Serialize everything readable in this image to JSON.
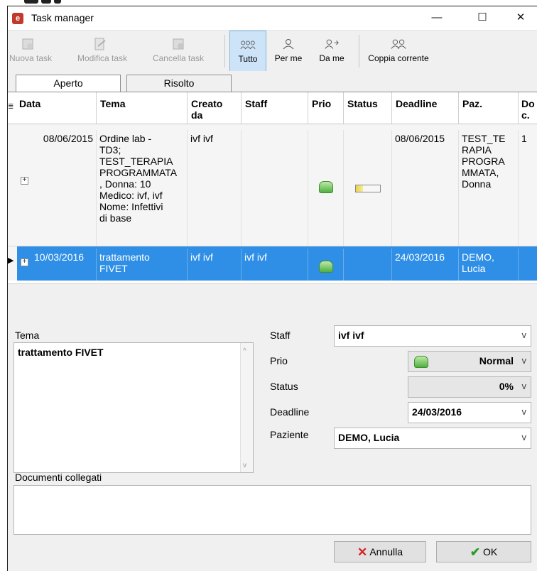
{
  "window": {
    "title": "Task manager",
    "minimize": "—",
    "maximize": "☐",
    "close": "✕"
  },
  "toolbar": {
    "new_task": "Nuova task",
    "edit_task": "Modifica task",
    "delete_task": "Cancella task",
    "all": "Tutto",
    "for_me": "Per me",
    "from_me": "Da me",
    "current_couple": "Coppia corrente"
  },
  "tabs": {
    "open": "Aperto",
    "resolved": "Risolto"
  },
  "grid": {
    "headers": {
      "data": "Data",
      "tema": "Tema",
      "creato_da": "Creato\nda",
      "staff": "Staff",
      "prio": "Prio",
      "status": "Status",
      "deadline": "Deadline",
      "paz": "Paz.",
      "doc": "Do\nc."
    },
    "rows": [
      {
        "data": "08/06/2015",
        "tema": "Ordine lab -\nTD3;\nTEST_TERAPIA\nPROGRAMMATA\n, Donna: 10\nMedico: ivf, ivf\nNome: Infettivi\ndi base",
        "creato_da": "ivf ivf",
        "staff": "",
        "deadline": "08/06/2015",
        "paz": "TEST_TE\nRAPIA\nPROGRA\nMMATA,\nDonna",
        "doc": "1",
        "status_progress": 0.3
      },
      {
        "data": "10/03/2016",
        "tema": "trattamento\nFIVET",
        "creato_da": "ivf ivf",
        "staff": "ivf ivf",
        "deadline": "24/03/2016",
        "paz": "DEMO,\nLucia",
        "doc": ""
      }
    ]
  },
  "detail": {
    "tema_label": "Tema",
    "tema_value": "trattamento FIVET",
    "staff_label": "Staff",
    "staff_value": "ivf ivf",
    "prio_label": "Prio",
    "prio_value": "Normal",
    "status_label": "Status",
    "status_value": "0%",
    "deadline_label": "Deadline",
    "deadline_value": "24/03/2016",
    "paziente_label": "Paziente",
    "paziente_value": "DEMO, Lucia",
    "documenti_label": "Documenti collegati"
  },
  "buttons": {
    "cancel": "Annulla",
    "ok": "OK"
  },
  "colors": {
    "selection": "#2f8fe6",
    "toolbar_active": "#cde3f7",
    "cancel_icon": "#d62020",
    "ok_icon": "#2a9a2a"
  }
}
